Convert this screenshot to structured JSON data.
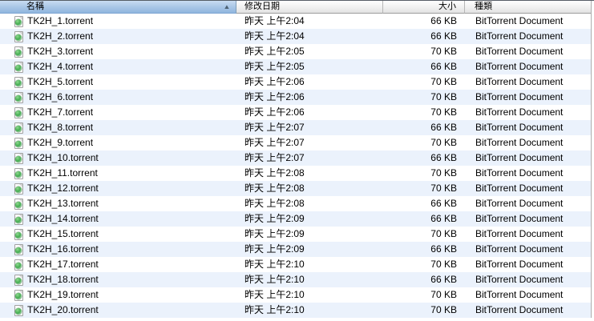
{
  "header": {
    "sort_arrow": "▲",
    "columns": [
      {
        "id": "name",
        "label": "名稱",
        "sorted": true,
        "sort_direction": "ascending"
      },
      {
        "id": "date_modified",
        "label": "修改日期",
        "sorted": false
      },
      {
        "id": "size",
        "label": "大小",
        "sorted": false
      },
      {
        "id": "kind",
        "label": "種類",
        "sorted": false
      }
    ]
  },
  "icons": {
    "file_icon": "torrent-document-icon",
    "sort_icon": "sort-ascending-icon"
  },
  "colors": {
    "alt_row_blue": "#ebf2fc",
    "sorted_header_top": "#c9dcf2",
    "sorted_header_bottom": "#8fb5de",
    "icon_green": "#3aa748"
  },
  "files": [
    {
      "name": "TK2H_1.torrent",
      "date_modified": "昨天 上午2:04",
      "size": "66 KB",
      "kind": "BitTorrent Document"
    },
    {
      "name": "TK2H_2.torrent",
      "date_modified": "昨天 上午2:04",
      "size": "66 KB",
      "kind": "BitTorrent Document"
    },
    {
      "name": "TK2H_3.torrent",
      "date_modified": "昨天 上午2:05",
      "size": "70 KB",
      "kind": "BitTorrent Document"
    },
    {
      "name": "TK2H_4.torrent",
      "date_modified": "昨天 上午2:05",
      "size": "66 KB",
      "kind": "BitTorrent Document"
    },
    {
      "name": "TK2H_5.torrent",
      "date_modified": "昨天 上午2:06",
      "size": "70 KB",
      "kind": "BitTorrent Document"
    },
    {
      "name": "TK2H_6.torrent",
      "date_modified": "昨天 上午2:06",
      "size": "70 KB",
      "kind": "BitTorrent Document"
    },
    {
      "name": "TK2H_7.torrent",
      "date_modified": "昨天 上午2:06",
      "size": "70 KB",
      "kind": "BitTorrent Document"
    },
    {
      "name": "TK2H_8.torrent",
      "date_modified": "昨天 上午2:07",
      "size": "66 KB",
      "kind": "BitTorrent Document"
    },
    {
      "name": "TK2H_9.torrent",
      "date_modified": "昨天 上午2:07",
      "size": "70 KB",
      "kind": "BitTorrent Document"
    },
    {
      "name": "TK2H_10.torrent",
      "date_modified": "昨天 上午2:07",
      "size": "66 KB",
      "kind": "BitTorrent Document"
    },
    {
      "name": "TK2H_11.torrent",
      "date_modified": "昨天 上午2:08",
      "size": "70 KB",
      "kind": "BitTorrent Document"
    },
    {
      "name": "TK2H_12.torrent",
      "date_modified": "昨天 上午2:08",
      "size": "70 KB",
      "kind": "BitTorrent Document"
    },
    {
      "name": "TK2H_13.torrent",
      "date_modified": "昨天 上午2:08",
      "size": "66 KB",
      "kind": "BitTorrent Document"
    },
    {
      "name": "TK2H_14.torrent",
      "date_modified": "昨天 上午2:09",
      "size": "66 KB",
      "kind": "BitTorrent Document"
    },
    {
      "name": "TK2H_15.torrent",
      "date_modified": "昨天 上午2:09",
      "size": "70 KB",
      "kind": "BitTorrent Document"
    },
    {
      "name": "TK2H_16.torrent",
      "date_modified": "昨天 上午2:09",
      "size": "66 KB",
      "kind": "BitTorrent Document"
    },
    {
      "name": "TK2H_17.torrent",
      "date_modified": "昨天 上午2:10",
      "size": "70 KB",
      "kind": "BitTorrent Document"
    },
    {
      "name": "TK2H_18.torrent",
      "date_modified": "昨天 上午2:10",
      "size": "66 KB",
      "kind": "BitTorrent Document"
    },
    {
      "name": "TK2H_19.torrent",
      "date_modified": "昨天 上午2:10",
      "size": "70 KB",
      "kind": "BitTorrent Document"
    },
    {
      "name": "TK2H_20.torrent",
      "date_modified": "昨天 上午2:10",
      "size": "70 KB",
      "kind": "BitTorrent Document"
    }
  ]
}
